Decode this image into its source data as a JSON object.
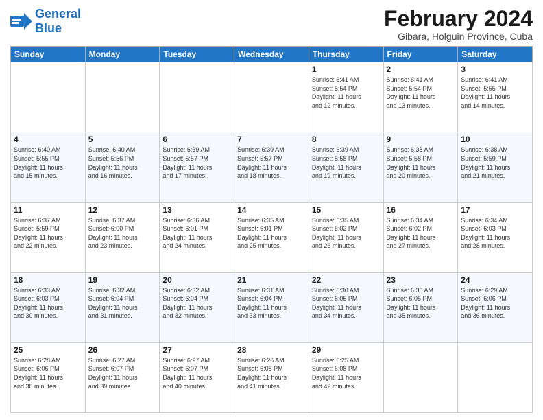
{
  "logo": {
    "part1": "General",
    "part2": "Blue"
  },
  "title": "February 2024",
  "location": "Gibara, Holguin Province, Cuba",
  "headers": [
    "Sunday",
    "Monday",
    "Tuesday",
    "Wednesday",
    "Thursday",
    "Friday",
    "Saturday"
  ],
  "weeks": [
    [
      {
        "day": "",
        "text": ""
      },
      {
        "day": "",
        "text": ""
      },
      {
        "day": "",
        "text": ""
      },
      {
        "day": "",
        "text": ""
      },
      {
        "day": "1",
        "text": "Sunrise: 6:41 AM\nSunset: 5:54 PM\nDaylight: 11 hours\nand 12 minutes."
      },
      {
        "day": "2",
        "text": "Sunrise: 6:41 AM\nSunset: 5:54 PM\nDaylight: 11 hours\nand 13 minutes."
      },
      {
        "day": "3",
        "text": "Sunrise: 6:41 AM\nSunset: 5:55 PM\nDaylight: 11 hours\nand 14 minutes."
      }
    ],
    [
      {
        "day": "4",
        "text": "Sunrise: 6:40 AM\nSunset: 5:55 PM\nDaylight: 11 hours\nand 15 minutes."
      },
      {
        "day": "5",
        "text": "Sunrise: 6:40 AM\nSunset: 5:56 PM\nDaylight: 11 hours\nand 16 minutes."
      },
      {
        "day": "6",
        "text": "Sunrise: 6:39 AM\nSunset: 5:57 PM\nDaylight: 11 hours\nand 17 minutes."
      },
      {
        "day": "7",
        "text": "Sunrise: 6:39 AM\nSunset: 5:57 PM\nDaylight: 11 hours\nand 18 minutes."
      },
      {
        "day": "8",
        "text": "Sunrise: 6:39 AM\nSunset: 5:58 PM\nDaylight: 11 hours\nand 19 minutes."
      },
      {
        "day": "9",
        "text": "Sunrise: 6:38 AM\nSunset: 5:58 PM\nDaylight: 11 hours\nand 20 minutes."
      },
      {
        "day": "10",
        "text": "Sunrise: 6:38 AM\nSunset: 5:59 PM\nDaylight: 11 hours\nand 21 minutes."
      }
    ],
    [
      {
        "day": "11",
        "text": "Sunrise: 6:37 AM\nSunset: 5:59 PM\nDaylight: 11 hours\nand 22 minutes."
      },
      {
        "day": "12",
        "text": "Sunrise: 6:37 AM\nSunset: 6:00 PM\nDaylight: 11 hours\nand 23 minutes."
      },
      {
        "day": "13",
        "text": "Sunrise: 6:36 AM\nSunset: 6:01 PM\nDaylight: 11 hours\nand 24 minutes."
      },
      {
        "day": "14",
        "text": "Sunrise: 6:35 AM\nSunset: 6:01 PM\nDaylight: 11 hours\nand 25 minutes."
      },
      {
        "day": "15",
        "text": "Sunrise: 6:35 AM\nSunset: 6:02 PM\nDaylight: 11 hours\nand 26 minutes."
      },
      {
        "day": "16",
        "text": "Sunrise: 6:34 AM\nSunset: 6:02 PM\nDaylight: 11 hours\nand 27 minutes."
      },
      {
        "day": "17",
        "text": "Sunrise: 6:34 AM\nSunset: 6:03 PM\nDaylight: 11 hours\nand 28 minutes."
      }
    ],
    [
      {
        "day": "18",
        "text": "Sunrise: 6:33 AM\nSunset: 6:03 PM\nDaylight: 11 hours\nand 30 minutes."
      },
      {
        "day": "19",
        "text": "Sunrise: 6:32 AM\nSunset: 6:04 PM\nDaylight: 11 hours\nand 31 minutes."
      },
      {
        "day": "20",
        "text": "Sunrise: 6:32 AM\nSunset: 6:04 PM\nDaylight: 11 hours\nand 32 minutes."
      },
      {
        "day": "21",
        "text": "Sunrise: 6:31 AM\nSunset: 6:04 PM\nDaylight: 11 hours\nand 33 minutes."
      },
      {
        "day": "22",
        "text": "Sunrise: 6:30 AM\nSunset: 6:05 PM\nDaylight: 11 hours\nand 34 minutes."
      },
      {
        "day": "23",
        "text": "Sunrise: 6:30 AM\nSunset: 6:05 PM\nDaylight: 11 hours\nand 35 minutes."
      },
      {
        "day": "24",
        "text": "Sunrise: 6:29 AM\nSunset: 6:06 PM\nDaylight: 11 hours\nand 36 minutes."
      }
    ],
    [
      {
        "day": "25",
        "text": "Sunrise: 6:28 AM\nSunset: 6:06 PM\nDaylight: 11 hours\nand 38 minutes."
      },
      {
        "day": "26",
        "text": "Sunrise: 6:27 AM\nSunset: 6:07 PM\nDaylight: 11 hours\nand 39 minutes."
      },
      {
        "day": "27",
        "text": "Sunrise: 6:27 AM\nSunset: 6:07 PM\nDaylight: 11 hours\nand 40 minutes."
      },
      {
        "day": "28",
        "text": "Sunrise: 6:26 AM\nSunset: 6:08 PM\nDaylight: 11 hours\nand 41 minutes."
      },
      {
        "day": "29",
        "text": "Sunrise: 6:25 AM\nSunset: 6:08 PM\nDaylight: 11 hours\nand 42 minutes."
      },
      {
        "day": "",
        "text": ""
      },
      {
        "day": "",
        "text": ""
      }
    ]
  ]
}
